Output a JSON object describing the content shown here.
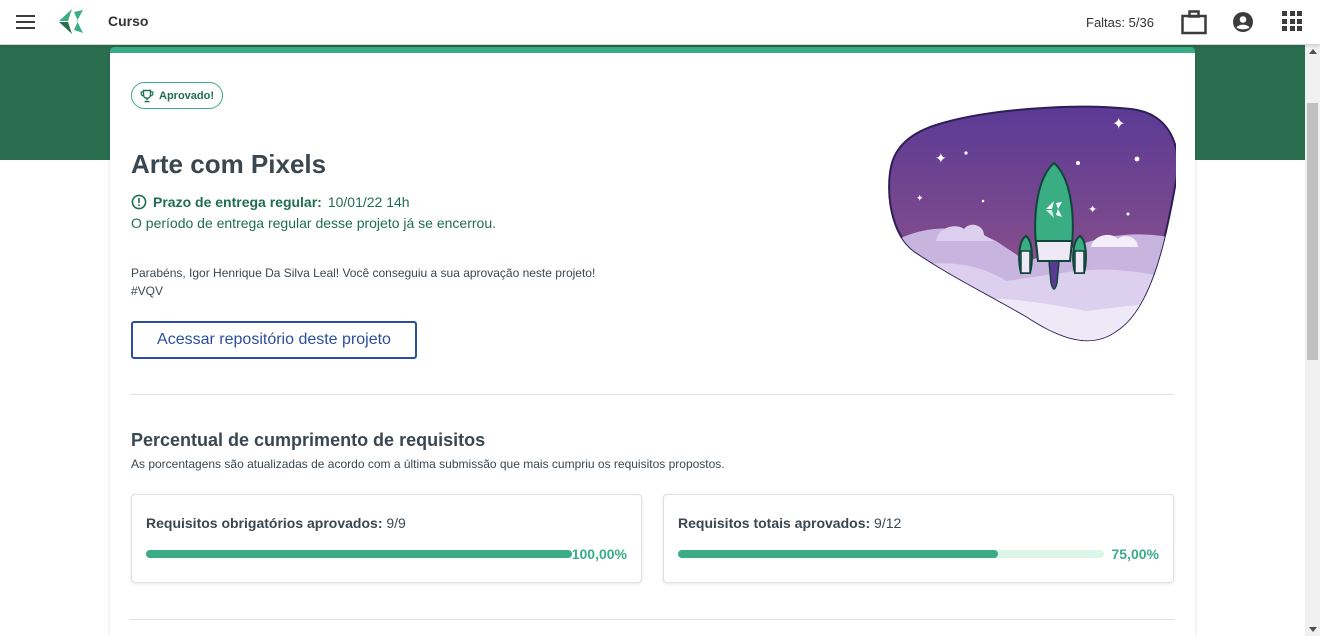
{
  "header": {
    "course_title": "Curso",
    "absences": "Faltas: 5/36",
    "icons": [
      "menu-icon",
      "logo",
      "briefcase-icon",
      "account-icon",
      "apps-grid-icon"
    ]
  },
  "project": {
    "badge": "Aprovado!",
    "title": "Arte com Pixels",
    "deadline_label": "Prazo de entrega regular:",
    "deadline_value": "10/01/22 14h",
    "deadline_message": "O período de entrega regular desse projeto já se encerrou.",
    "congrats_line1": "Parabéns, Igor Henrique Da Silva Leal! Você conseguiu a sua aprovação neste projeto!",
    "congrats_line2": "#VQV",
    "repo_button": "Acessar repositório deste projeto"
  },
  "requirements": {
    "title": "Percentual de cumprimento de requisitos",
    "subtitle": "As porcentagens são atualizadas de acordo com a última submissão que mais cumpriu os requisitos propostos.",
    "cards": [
      {
        "label": "Requisitos obrigatórios aprovados:",
        "value": "9/9",
        "percent_text": "100,00%",
        "fraction": 1.0
      },
      {
        "label": "Requisitos totais aprovados:",
        "value": "9/12",
        "percent_text": "75,00%",
        "fraction": 0.75
      }
    ]
  },
  "colors": {
    "brand_green": "#2b6e4f",
    "accent": "#3aad85",
    "link_blue": "#2b4f9e"
  }
}
